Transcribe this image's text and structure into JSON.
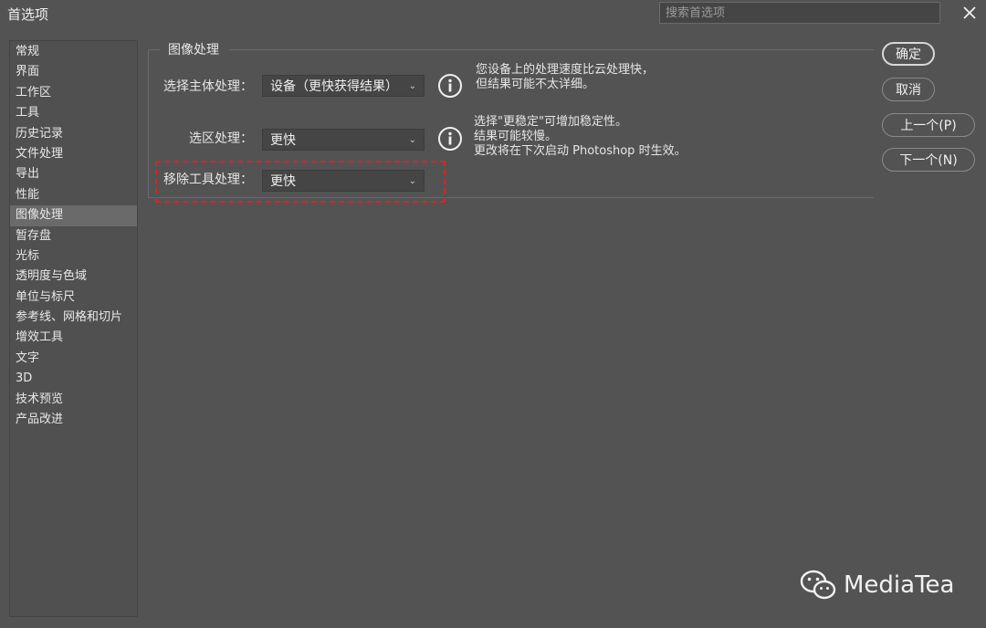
{
  "window": {
    "title": "首选项",
    "search_placeholder": "搜索首选项"
  },
  "sidebar": {
    "items": [
      {
        "label": "常规"
      },
      {
        "label": "界面"
      },
      {
        "label": "工作区"
      },
      {
        "label": "工具"
      },
      {
        "label": "历史记录"
      },
      {
        "label": "文件处理"
      },
      {
        "label": "导出"
      },
      {
        "label": "性能"
      },
      {
        "label": "图像处理",
        "active": true
      },
      {
        "label": "暂存盘"
      },
      {
        "label": "光标"
      },
      {
        "label": "透明度与色域"
      },
      {
        "label": "单位与标尺"
      },
      {
        "label": "参考线、网格和切片"
      },
      {
        "label": "增效工具"
      },
      {
        "label": "文字"
      },
      {
        "label": "3D"
      },
      {
        "label": "技术预览"
      },
      {
        "label": "产品改进"
      }
    ]
  },
  "panel": {
    "group_title": "图像处理",
    "subject": {
      "label": "选择主体处理：",
      "value": "设备（更快获得结果）",
      "note_lines": [
        "您设备上的处理速度比云处理快，",
        "但结果可能不太详细。"
      ]
    },
    "selection": {
      "label": "选区处理：",
      "value": "更快",
      "note_lines": [
        "选择\"更稳定\"可增加稳定性。",
        "结果可能较慢。",
        "更改将在下次启动 Photoshop 时生效。"
      ]
    },
    "remove_tool": {
      "label": "移除工具处理：",
      "value": "更快"
    }
  },
  "buttons": {
    "ok": "确定",
    "cancel": "取消",
    "prev": "上一个(P)",
    "next": "下一个(N)"
  },
  "watermark": {
    "text": "MediaTea"
  }
}
